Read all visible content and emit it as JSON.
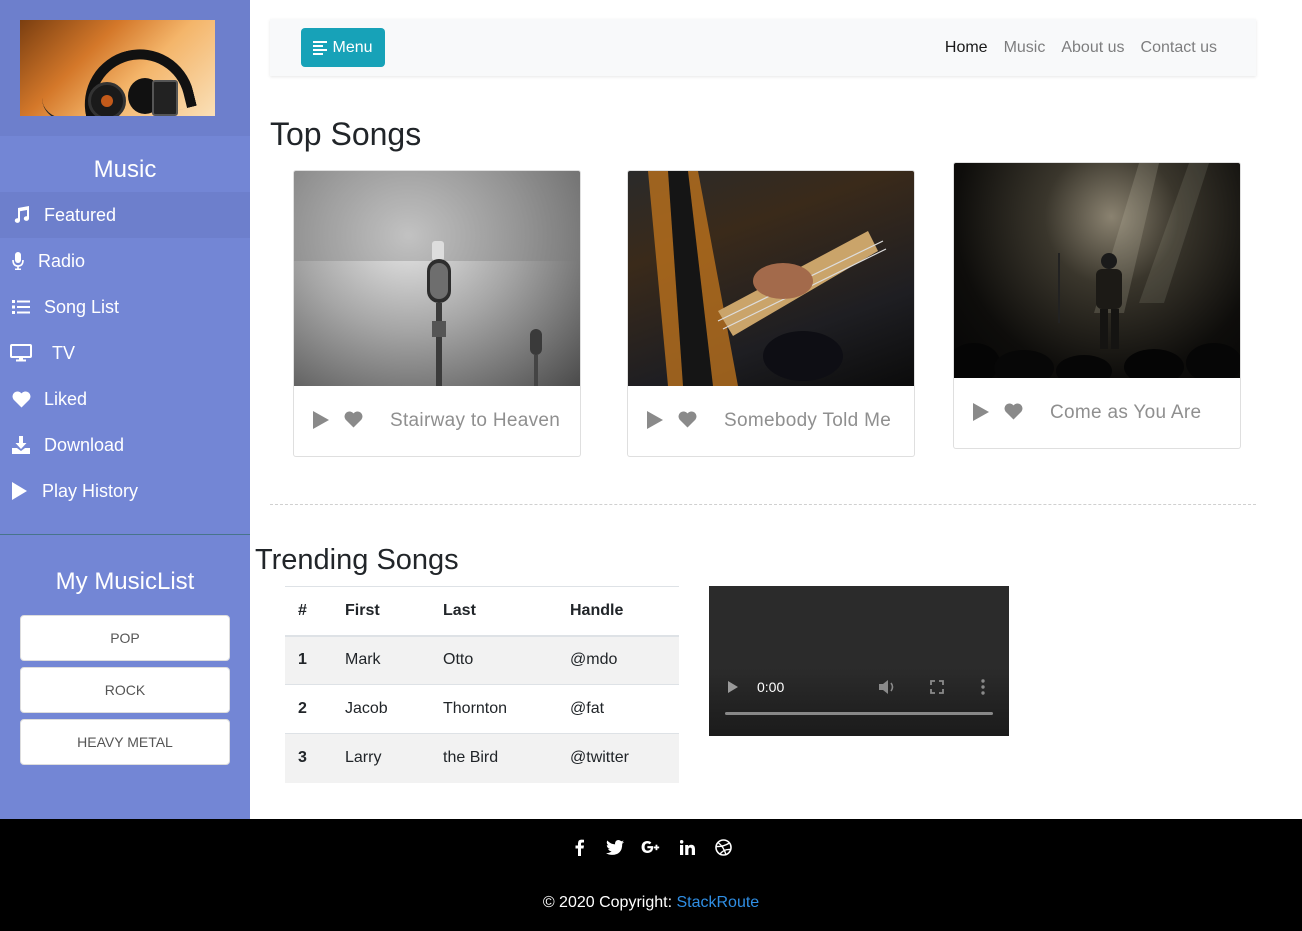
{
  "sidebar": {
    "section_title": "Music",
    "items": [
      {
        "label": "Featured",
        "icon": "music-note-icon"
      },
      {
        "label": "Radio",
        "icon": "microphone-icon"
      },
      {
        "label": "Song List",
        "icon": "list-icon"
      },
      {
        "label": "TV",
        "icon": "tv-icon"
      },
      {
        "label": "Liked",
        "icon": "heart-icon"
      },
      {
        "label": "Download",
        "icon": "download-icon"
      },
      {
        "label": "Play History",
        "icon": "play-icon"
      }
    ],
    "mylist_title": "My MusicList",
    "genres": [
      "POP",
      "ROCK",
      "HEAVY METAL"
    ]
  },
  "navbar": {
    "menu_label": "Menu",
    "links": [
      "Home",
      "Music",
      "About us",
      "Contact us"
    ]
  },
  "top_songs": {
    "title": "Top Songs",
    "cards": [
      {
        "song": "Stairway to Heaven"
      },
      {
        "song": "Somebody Told Me"
      },
      {
        "song": "Come as You Are"
      }
    ]
  },
  "trending": {
    "title": "Trending Songs",
    "columns": [
      "#",
      "First",
      "Last",
      "Handle"
    ],
    "rows": [
      [
        "1",
        "Mark",
        "Otto",
        "@mdo"
      ],
      [
        "2",
        "Jacob",
        "Thornton",
        "@fat"
      ],
      [
        "3",
        "Larry",
        "the Bird",
        "@twitter"
      ]
    ]
  },
  "video": {
    "time": "0:00"
  },
  "footer": {
    "copyright": "© 2020 Copyright:",
    "link": "StackRoute",
    "social": [
      "facebook-icon",
      "twitter-icon",
      "google-plus-icon",
      "linkedin-icon",
      "dribbble-icon"
    ]
  },
  "colors": {
    "sidebar": "#7386d5",
    "sidebar_active": "#6d7fcc",
    "menu_button": "#17a2b8",
    "footer": "#000000",
    "link": "#2f8ee4"
  }
}
